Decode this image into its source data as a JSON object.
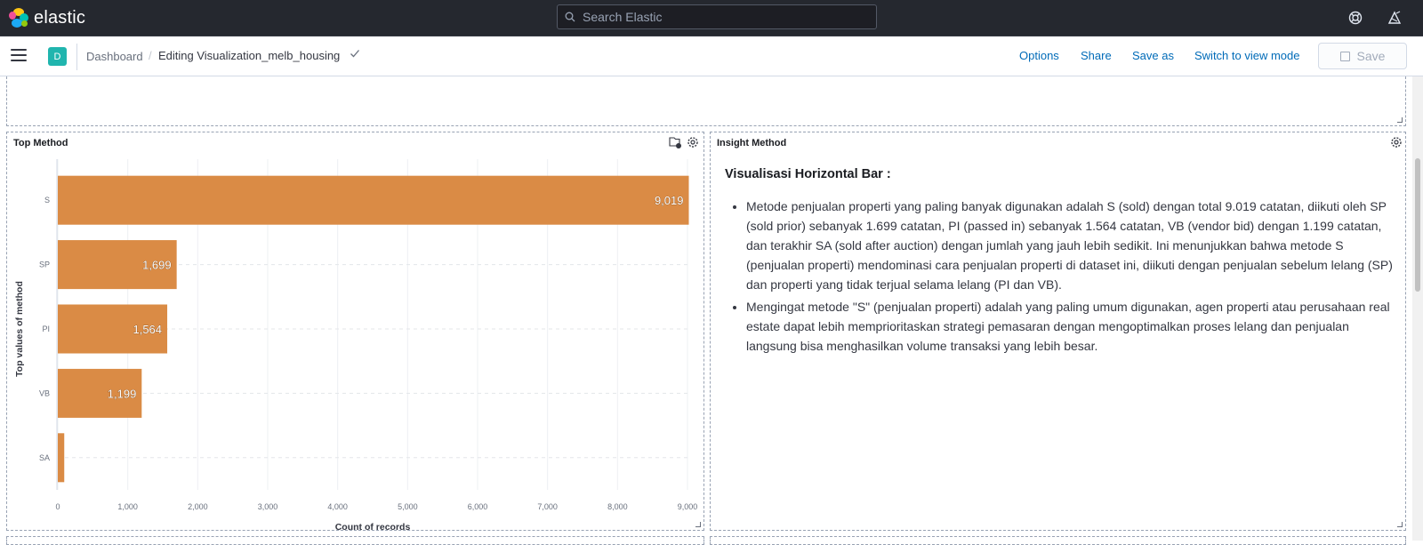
{
  "header": {
    "logo_text": "elastic",
    "search_placeholder": "Search Elastic"
  },
  "nav": {
    "space_initial": "D",
    "breadcrumb_root": "Dashboard",
    "breadcrumb_separator": "/",
    "breadcrumb_current": "Editing Visualization_melb_housing",
    "links": [
      "Options",
      "Share",
      "Save as",
      "Switch to view mode"
    ],
    "save_label": "Save"
  },
  "panels": {
    "chart_title": "Top Method",
    "insight_title": "Insight Method"
  },
  "insight": {
    "heading": "Visualisasi Horizontal Bar :",
    "bullets": [
      "Metode penjualan properti yang paling banyak digunakan adalah S (sold) dengan total 9.019 catatan, diikuti oleh SP (sold prior) sebanyak 1.699 catatan, PI (passed in) sebanyak 1.564 catatan, VB (vendor bid) dengan 1.199 catatan, dan terakhir SA (sold after auction) dengan jumlah yang jauh lebih sedikit. Ini menunjukkan bahwa metode S (penjualan properti) mendominasi cara penjualan properti di dataset ini, diikuti dengan penjualan sebelum lelang (SP) dan properti yang tidak terjual selama lelang (PI dan VB).",
      "Mengingat metode \"S\" (penjualan properti) adalah yang paling umum digunakan, agen properti atau perusahaan real estate dapat lebih memprioritaskan strategi pemasaran dengan mengoptimalkan proses lelang dan penjualan langsung bisa menghasilkan volume transaksi yang lebih besar."
    ]
  },
  "chart_data": {
    "type": "bar",
    "orientation": "horizontal",
    "title": "",
    "categories": [
      "S",
      "SP",
      "PI",
      "VB",
      "SA"
    ],
    "values": [
      9019,
      1699,
      1564,
      1199,
      92
    ],
    "value_labels": [
      "9,019",
      "1,699",
      "1,564",
      "1,199",
      ""
    ],
    "xlabel": "Count of records",
    "ylabel": "Top values of method",
    "xlim": [
      0,
      9000
    ],
    "x_ticks": [
      "0",
      "1,000",
      "2,000",
      "3,000",
      "4,000",
      "5,000",
      "6,000",
      "7,000",
      "8,000",
      "9,000"
    ],
    "bar_color": "#da8b45",
    "grid": true
  }
}
